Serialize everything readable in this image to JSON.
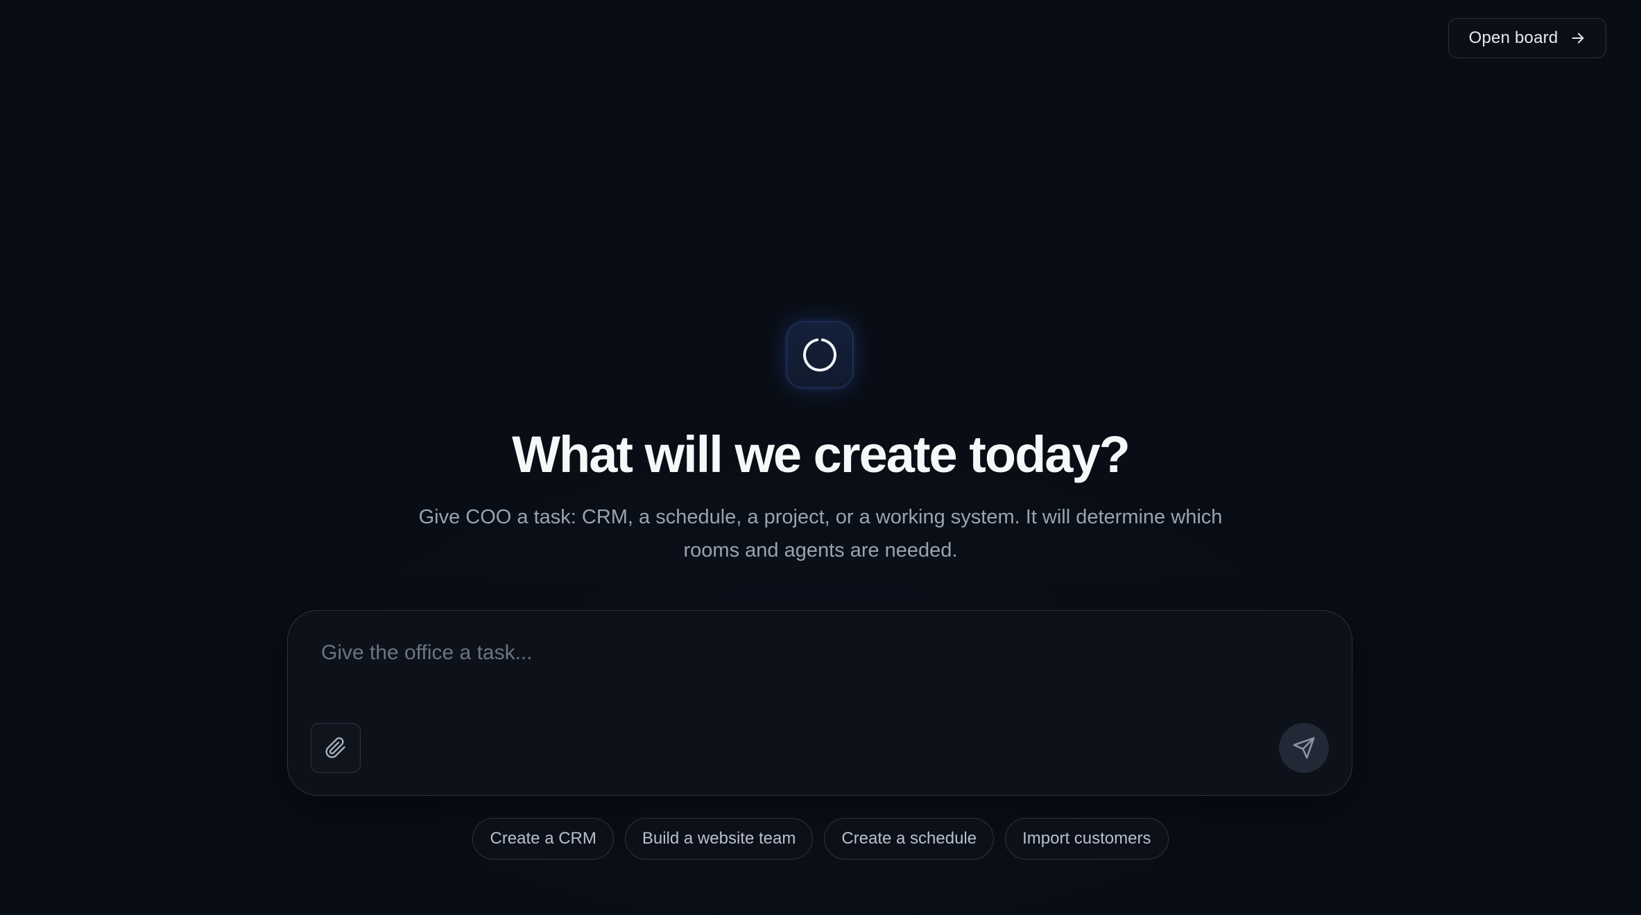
{
  "header": {
    "open_board_label": "Open board",
    "open_board_icon": "arrow-right-icon"
  },
  "hero": {
    "logo_icon": "spinner-ring-icon",
    "title": "What will we create today?",
    "subtitle": "Give COO a task: CRM, a schedule, a project, or a working system. It will determine which rooms and agents are needed."
  },
  "composer": {
    "placeholder": "Give the office a task...",
    "value": "",
    "attach_icon": "paperclip-icon",
    "send_icon": "send-icon"
  },
  "suggestions": [
    {
      "label": "Create a CRM"
    },
    {
      "label": "Build a website team"
    },
    {
      "label": "Create a schedule"
    },
    {
      "label": "Import customers"
    }
  ],
  "colors": {
    "background": "#090d15",
    "accent_glow": "#345cbe",
    "text_primary": "#f6f7f9",
    "text_secondary": "#9ba3b1",
    "placeholder": "#6c7483"
  }
}
